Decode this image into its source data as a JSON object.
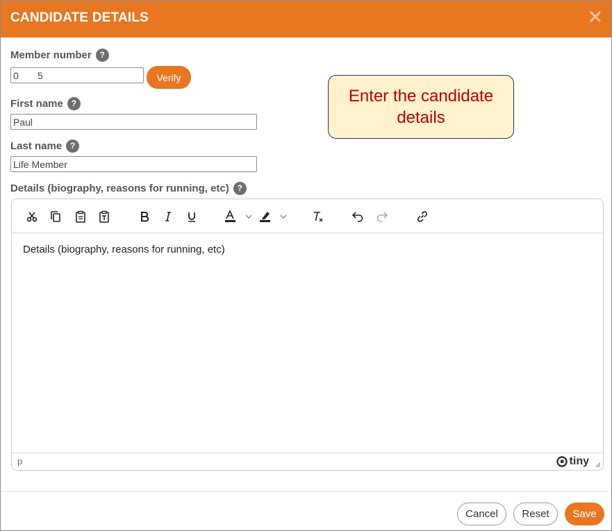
{
  "dialog": {
    "title": "CANDIDATE DETAILS"
  },
  "fields": {
    "member_number": {
      "label": "Member number",
      "value": "0       5"
    },
    "verify_label": "Verify",
    "first_name": {
      "label": "First name",
      "value": "Paul"
    },
    "last_name": {
      "label": "Last name",
      "value": "Life Member"
    },
    "details": {
      "label": "Details (biography, reasons for running, etc)"
    }
  },
  "help_glyph": "?",
  "callout": {
    "text": "Enter the candidate details"
  },
  "editor": {
    "toolbar": [
      "cut-icon",
      "copy-icon",
      "paste-icon",
      "paste-text-icon",
      "bold-icon",
      "italic-icon",
      "underline-icon",
      "text-color-icon",
      "highlight-color-icon",
      "clear-formatting-icon",
      "undo-icon",
      "redo-icon",
      "link-icon"
    ],
    "content": "Details (biography, reasons for running, etc)",
    "status_path": "p",
    "brand": "tiny"
  },
  "actions": {
    "cancel": "Cancel",
    "reset": "Reset",
    "save": "Save"
  },
  "colors": {
    "accent": "#e87722",
    "callout_bg": "#fff2cc",
    "callout_text": "#c00000"
  }
}
